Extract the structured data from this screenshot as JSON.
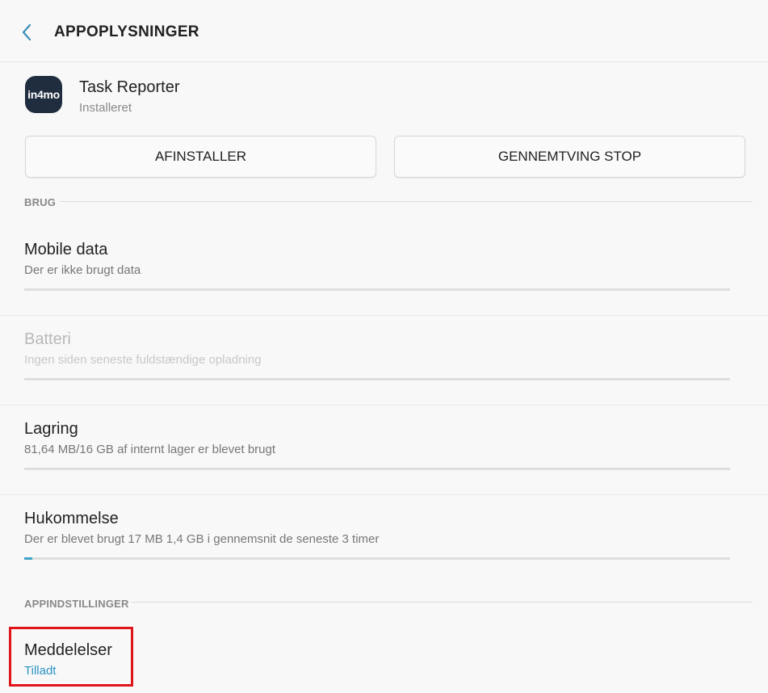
{
  "header": {
    "title": "APPOPLYSNINGER",
    "back_icon": "chevron-left-icon"
  },
  "app": {
    "icon_text": "in4mo",
    "icon_color": "#1f2d3f",
    "name": "Task Reporter",
    "status": "Installeret"
  },
  "buttons": {
    "uninstall": "AFINSTALLER",
    "force_stop": "GENNEMTVING STOP"
  },
  "sections": {
    "usage": "BRUG",
    "app_settings": "APPINDSTILLINGER"
  },
  "usage_items": [
    {
      "title": "Mobile data",
      "subtitle": "Der er ikke brugt data",
      "enabled": true,
      "progress": 0
    },
    {
      "title": "Batteri",
      "subtitle": "Ingen siden seneste fuldstændige opladning",
      "enabled": false,
      "progress": 0
    },
    {
      "title": "Lagring",
      "subtitle": "81,64 MB/16 GB af internt lager er blevet brugt",
      "enabled": true,
      "progress": 0
    },
    {
      "title": "Hukommelse",
      "subtitle": "Der er blevet brugt 17 MB 1,4 GB i gennemsnit de seneste 3 timer",
      "enabled": true,
      "progress": 0.012
    }
  ],
  "notifications": {
    "title": "Meddelelser",
    "value": "Tilladt"
  },
  "colors": {
    "accent": "#2a94c4",
    "highlight": "#e0151b",
    "progress": "#3fa3c8"
  }
}
